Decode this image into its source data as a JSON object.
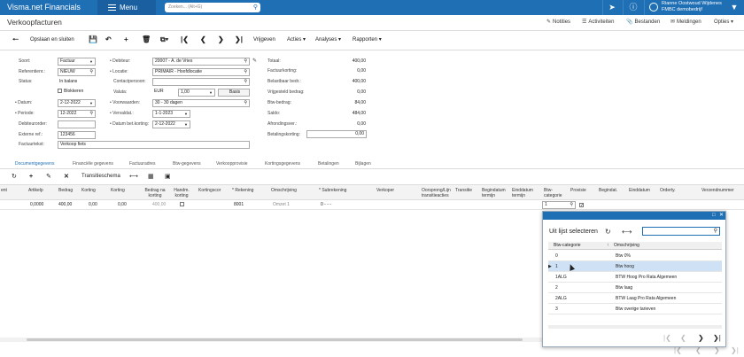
{
  "brand": "Visma.net Financials",
  "menu_label": "Menu",
  "search_placeholder": "Zoeken... (Alt+G)",
  "user": {
    "name": "Rianne Oostwoud Wijdenes",
    "company": "FMBC demobedrijf"
  },
  "page_title": "Verkoopfacturen",
  "page_actions": [
    "Notities",
    "Activiteiten",
    "Bestanden",
    "Meldingen",
    "Opties"
  ],
  "toolbar": {
    "save_close": "Opslaan en sluiten",
    "release": "Vrijgeven",
    "actions": "Acties",
    "analyses": "Analyses",
    "reports": "Rapporten"
  },
  "form": {
    "soort_label": "Soort:",
    "soort": "Factuur",
    "ref_label": "Referentienr.:",
    "ref": "NIEUW",
    "status_label": "Status:",
    "status": "In balans",
    "block_label": "Blokkeren",
    "datum_label": "Datum:",
    "datum": "2-12-2022",
    "periode_label": "Periode:",
    "periode": "12-2022",
    "debref_label": "Debiteurorder:",
    "debref": "",
    "extref_label": "Externe ref.:",
    "extref": "123456",
    "invtext_label": "Factuurtekst:",
    "invtext": "Verkoop fiets",
    "debiteur_label": "Debiteur:",
    "debiteur": "20007 - A. de Vries",
    "locatie_label": "Locatie:",
    "locatie": "PRIMAIR - Hoofdlocatie",
    "contact_label": "Contactpersoon:",
    "contact": "",
    "valuta_label": "Valuta:",
    "valuta": "EUR",
    "koers": "1,00",
    "basis": "Basis",
    "voorwaarden_label": "Voorwaarden:",
    "voorwaarden": "30 - 30 dagen",
    "vervaldat_label": "Vervaldat.:",
    "vervaldat": "1-1-2023",
    "kortingdat_label": "Datum bet.korting:",
    "kortingdat": "2-12-2022"
  },
  "totals": [
    {
      "label": "Totaal:",
      "value": "400,00"
    },
    {
      "label": "Factuurkorting:",
      "value": "0,00"
    },
    {
      "label": "Belastbaar bedr.:",
      "value": "400,00"
    },
    {
      "label": "Vrijgesteld bedrag:",
      "value": "0,00"
    },
    {
      "label": "Btw-bedrag:",
      "value": "84,00"
    },
    {
      "label": "Saldo:",
      "value": "484,00"
    },
    {
      "label": "Afrondingsver.:",
      "value": "0,00"
    },
    {
      "label": "Betalingskorting:",
      "value": "0,00"
    }
  ],
  "tabs": [
    "Documentgegevens",
    "Financiële gegevens",
    "Factuuradres",
    "Btw-gegevens",
    "Verkoopprovisie",
    "Kortingsgegevens",
    "Betalingen",
    "Bijlagen"
  ],
  "grid_toolbar": {
    "transition": "Transitieschema"
  },
  "grid_headers": [
    "Artikelp",
    "Bedrag",
    "Korting",
    "Korting",
    "Bedrag na korting",
    "Handm. korting",
    "Kortingscor",
    "* Rekening",
    "Omschrijving",
    "* Subrekening",
    "Verkoper",
    "Oorsprong/Lijn transitieacties",
    "Transitie",
    "Begindatum termijn",
    "Einddatum termijn",
    "Btw-categorie",
    "Provisie",
    "Begindat.",
    "Einddatum",
    "Orderty.",
    "Verzendnummer"
  ],
  "grid_row": {
    "artikelp": "0,0000",
    "bedrag": "400,00",
    "korting1": "0,00",
    "korting2": "0,00",
    "nakorting": "400,00",
    "rekening": "8001",
    "omschrijving": "Omzet 1",
    "subrek": "0 - - -",
    "btwcat": "1"
  },
  "popup": {
    "title": "Uit lijst selecteren",
    "headers": [
      "Btw-categorie",
      "Omschrijving"
    ],
    "rows": [
      {
        "code": "0",
        "desc": "Btw 0%"
      },
      {
        "code": "1",
        "desc": "Btw hoog"
      },
      {
        "code": "1ALG",
        "desc": "BTW Hoog Pro Rata Algemeen"
      },
      {
        "code": "2",
        "desc": "Btw laag"
      },
      {
        "code": "2ALG",
        "desc": "BTW Laag Pro Rata Algemeen"
      },
      {
        "code": "3",
        "desc": "Btw overige tarieven"
      }
    ],
    "selected_index": 1
  },
  "colors": {
    "topbar": "#1f6fb5",
    "accent": "#1f6fb5",
    "selected_row": "#cfe2f5"
  }
}
